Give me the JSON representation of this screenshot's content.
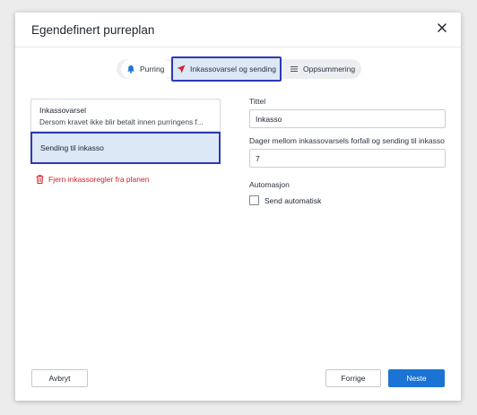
{
  "dialog": {
    "title": "Egendefinert purreplan"
  },
  "tabs": [
    {
      "label": "Purring",
      "icon": "bell-icon"
    },
    {
      "label": "Inkassovarsel og sending",
      "icon": "send-arrow-icon",
      "active": true
    },
    {
      "label": "Oppsummering",
      "icon": "list-icon"
    }
  ],
  "rules": [
    {
      "title": "Inkassovarsel",
      "subtitle": "Dersom kravet ikke blir betalt innen purringens f..."
    },
    {
      "title": "Sending til inkasso",
      "selected": true
    }
  ],
  "remove_label": "Fjern inkassoregler fra planen",
  "form": {
    "title_label": "Tittel",
    "title_value": "Inkasso",
    "days_label": "Dager mellom inkassovarsels forfall og sending til inkasso",
    "days_value": "7",
    "automation_label": "Automasjon",
    "auto_send_label": "Send automatisk",
    "auto_send_checked": false
  },
  "buttons": {
    "cancel": "Avbryt",
    "previous": "Forrige",
    "next": "Neste"
  },
  "colors": {
    "accent": "#1b74d4",
    "highlight_border": "#2c3ab5",
    "selected_bg": "#dce8f5",
    "danger": "#d0242c"
  }
}
